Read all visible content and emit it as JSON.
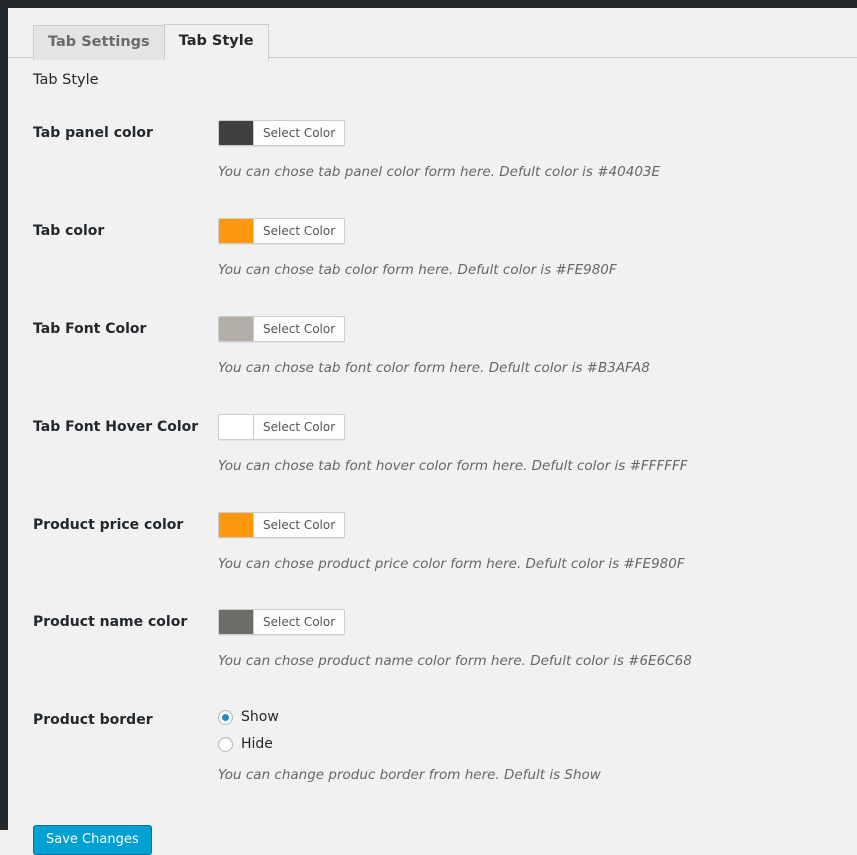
{
  "window": {
    "accent_color": "#00a0d2",
    "rail_color": "#23282d",
    "page_background": "#f1f1f1"
  },
  "tabs": [
    {
      "label": "Tab Settings",
      "active": false
    },
    {
      "label": "Tab Style",
      "active": true
    }
  ],
  "section": {
    "title": "Tab Style"
  },
  "fields": [
    {
      "label": "Tab panel color",
      "button_label": "Select Color",
      "swatch_color": "#40403E",
      "description": "You can chose tab panel color form here. Defult color is #40403E"
    },
    {
      "label": "Tab color",
      "button_label": "Select Color",
      "swatch_color": "#FE980F",
      "description": "You can chose tab color form here. Defult color is #FE980F"
    },
    {
      "label": "Tab Font Color",
      "button_label": "Select Color",
      "swatch_color": "#B3AFA8",
      "description": "You can chose tab font color form here. Defult color is #B3AFA8"
    },
    {
      "label": "Tab Font Hover Color",
      "button_label": "Select Color",
      "swatch_color": "#FFFFFF",
      "description": "You can chose tab font hover color form here. Defult color is #FFFFFF"
    },
    {
      "label": "Product price color",
      "button_label": "Select Color",
      "swatch_color": "#FE980F",
      "description": "You can chose product price color form here. Defult color is #FE980F"
    },
    {
      "label": "Product name color",
      "button_label": "Select Color",
      "swatch_color": "#6E6C68",
      "description": "You can chose product name color form here. Defult color is #6E6C68"
    }
  ],
  "product_border": {
    "label": "Product border",
    "options": [
      {
        "label": "Show",
        "selected": true
      },
      {
        "label": "Hide",
        "selected": false
      }
    ],
    "description": "You can change produc border from here. Defult is Show"
  },
  "submit": {
    "label": "Save Changes"
  }
}
